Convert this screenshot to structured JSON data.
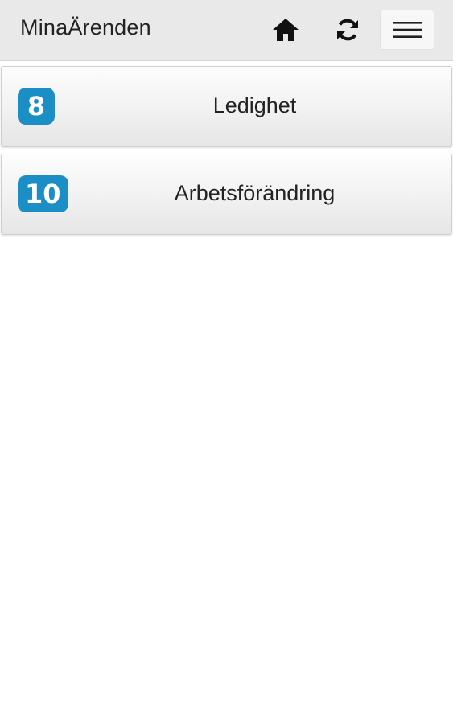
{
  "header": {
    "title": "MinaÄrenden",
    "home_icon": "home-icon",
    "refresh_icon": "refresh-icon",
    "menu_icon": "hamburger-menu-icon"
  },
  "colors": {
    "header_bg": "#e9e9e9",
    "badge_bg": "#1a8ec5",
    "text": "#222222"
  },
  "items": [
    {
      "count": "8",
      "label": "Ledighet"
    },
    {
      "count": "10",
      "label": "Arbetsförändring"
    }
  ]
}
